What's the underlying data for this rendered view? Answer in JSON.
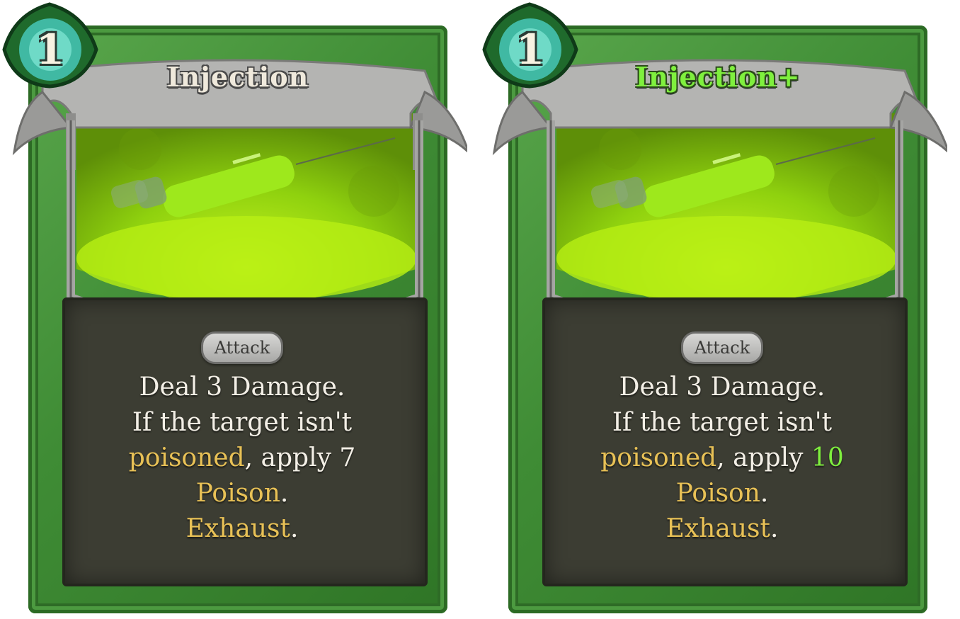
{
  "cards": [
    {
      "cost": "1",
      "title": "Injection",
      "type": "Attack",
      "desc": {
        "line1": "Deal 3 Damage.",
        "line2": "If the target isn't",
        "kw_poisoned": "poisoned",
        "apply_text": ", apply ",
        "amount": "7",
        "kw_poison": "Poison",
        "kw_exhaust": "Exhaust",
        "period": "."
      }
    },
    {
      "cost": "1",
      "title": "Injection+",
      "type": "Attack",
      "desc": {
        "line1": "Deal 3 Damage.",
        "line2": "If the target isn't",
        "kw_poisoned": "poisoned",
        "apply_text": ", apply ",
        "amount": "10",
        "kw_poison": "Poison",
        "kw_exhaust": "Exhaust",
        "period": "."
      }
    }
  ],
  "colors": {
    "frame_green": "#3f8c35",
    "art_green": "#a8e81a",
    "keyword_gold": "#e8c156",
    "upgrade_green": "#7ff03e",
    "body_dark": "#3c3d33"
  }
}
